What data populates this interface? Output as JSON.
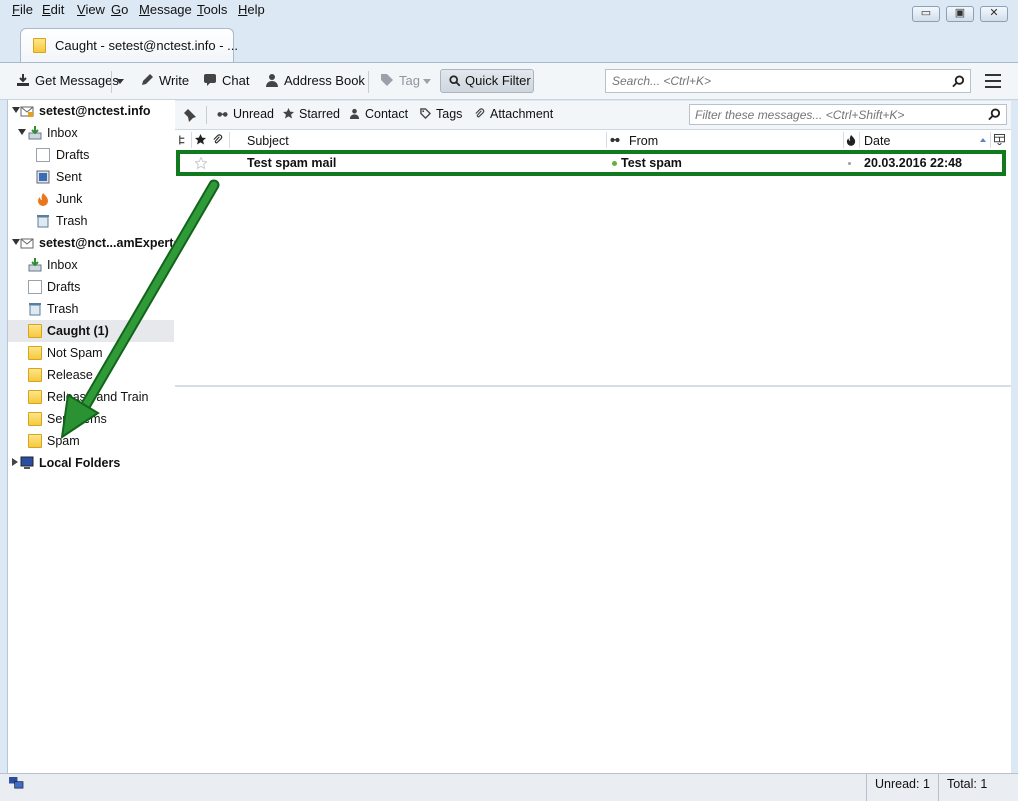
{
  "menubar": {
    "items": [
      "File",
      "Edit",
      "View",
      "Go",
      "Message",
      "Tools",
      "Help"
    ]
  },
  "window_controls": {
    "minimize": "▭",
    "maximize": "▣",
    "close": "✕"
  },
  "tab": {
    "label": "Caught - setest@nctest.info - ..."
  },
  "toolbar": {
    "get_messages": "Get Messages",
    "write": "Write",
    "chat": "Chat",
    "address_book": "Address Book",
    "tag": "Tag",
    "quick_filter": "Quick Filter",
    "search_placeholder": "Search... <Ctrl+K>"
  },
  "folders": {
    "account1": {
      "name": "setest@nctest.info",
      "items": [
        "Inbox",
        "Drafts",
        "Sent",
        "Junk",
        "Trash"
      ]
    },
    "account2": {
      "name": "setest@nct...amExperts",
      "items": [
        "Inbox",
        "Drafts",
        "Trash",
        "Caught (1)",
        "Not Spam",
        "Release",
        "Release and Train",
        "Sent Items",
        "Spam"
      ]
    },
    "local": {
      "name": "Local Folders"
    }
  },
  "quickfilter": {
    "unread": "Unread",
    "starred": "Starred",
    "contact": "Contact",
    "tags": "Tags",
    "attachment": "Attachment",
    "filter_placeholder": "Filter these messages... <Ctrl+Shift+K>"
  },
  "columns": {
    "subject": "Subject",
    "from": "From",
    "date": "Date"
  },
  "messages": [
    {
      "subject": "Test spam mail",
      "from": "Test spam",
      "date": "20.03.2016 22:48"
    }
  ],
  "statusbar": {
    "unread": "Unread: 1",
    "total": "Total: 1"
  },
  "colors": {
    "highlight": "#127a1e",
    "arrow": "#1f8a2a"
  }
}
